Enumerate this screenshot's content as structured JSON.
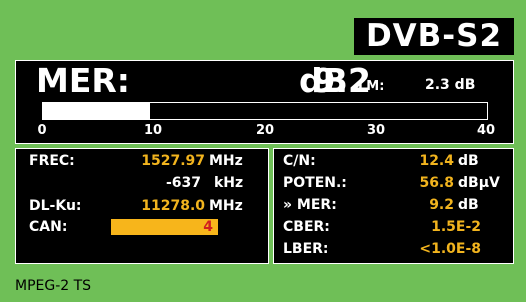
{
  "header": {
    "standard": "DVB-S2"
  },
  "mer": {
    "label": "MER:",
    "value": "9.2",
    "unit": "dB",
    "lm_label": "LM:",
    "lm_value": "2.3 dB",
    "bar_percent": 24,
    "scale": [
      "0",
      "10",
      "20",
      "30",
      "40"
    ]
  },
  "left": {
    "frec_label": "FREC:",
    "frec_value": "1527.97",
    "frec_unit": "MHz",
    "offset_value": "-637",
    "offset_unit": "kHz",
    "dl_label": "DL-Ku:",
    "dl_value": "11278.0",
    "dl_unit": "MHz",
    "can_label": "CAN:",
    "can_value": "4"
  },
  "right": {
    "cn_label": "C/N:",
    "cn_value": "12.4",
    "cn_unit": "dB",
    "poten_label": "POTEN.:",
    "poten_value": "56.8",
    "poten_unit": "dBµV",
    "mer_label": "» MER:",
    "mer_value": "9.2",
    "mer_unit": "dB",
    "cber_label": "CBER:",
    "cber_value": "1.5E-2",
    "lber_label": "LBER:",
    "lber_value": "<1.0E-8"
  },
  "status": {
    "text": "MPEG-2 TS"
  },
  "colors": {
    "background": "#6fbf57",
    "panel": "#000000",
    "value": "#f2b41e",
    "can_box": "#f7b51b",
    "can_text": "#d12020"
  }
}
